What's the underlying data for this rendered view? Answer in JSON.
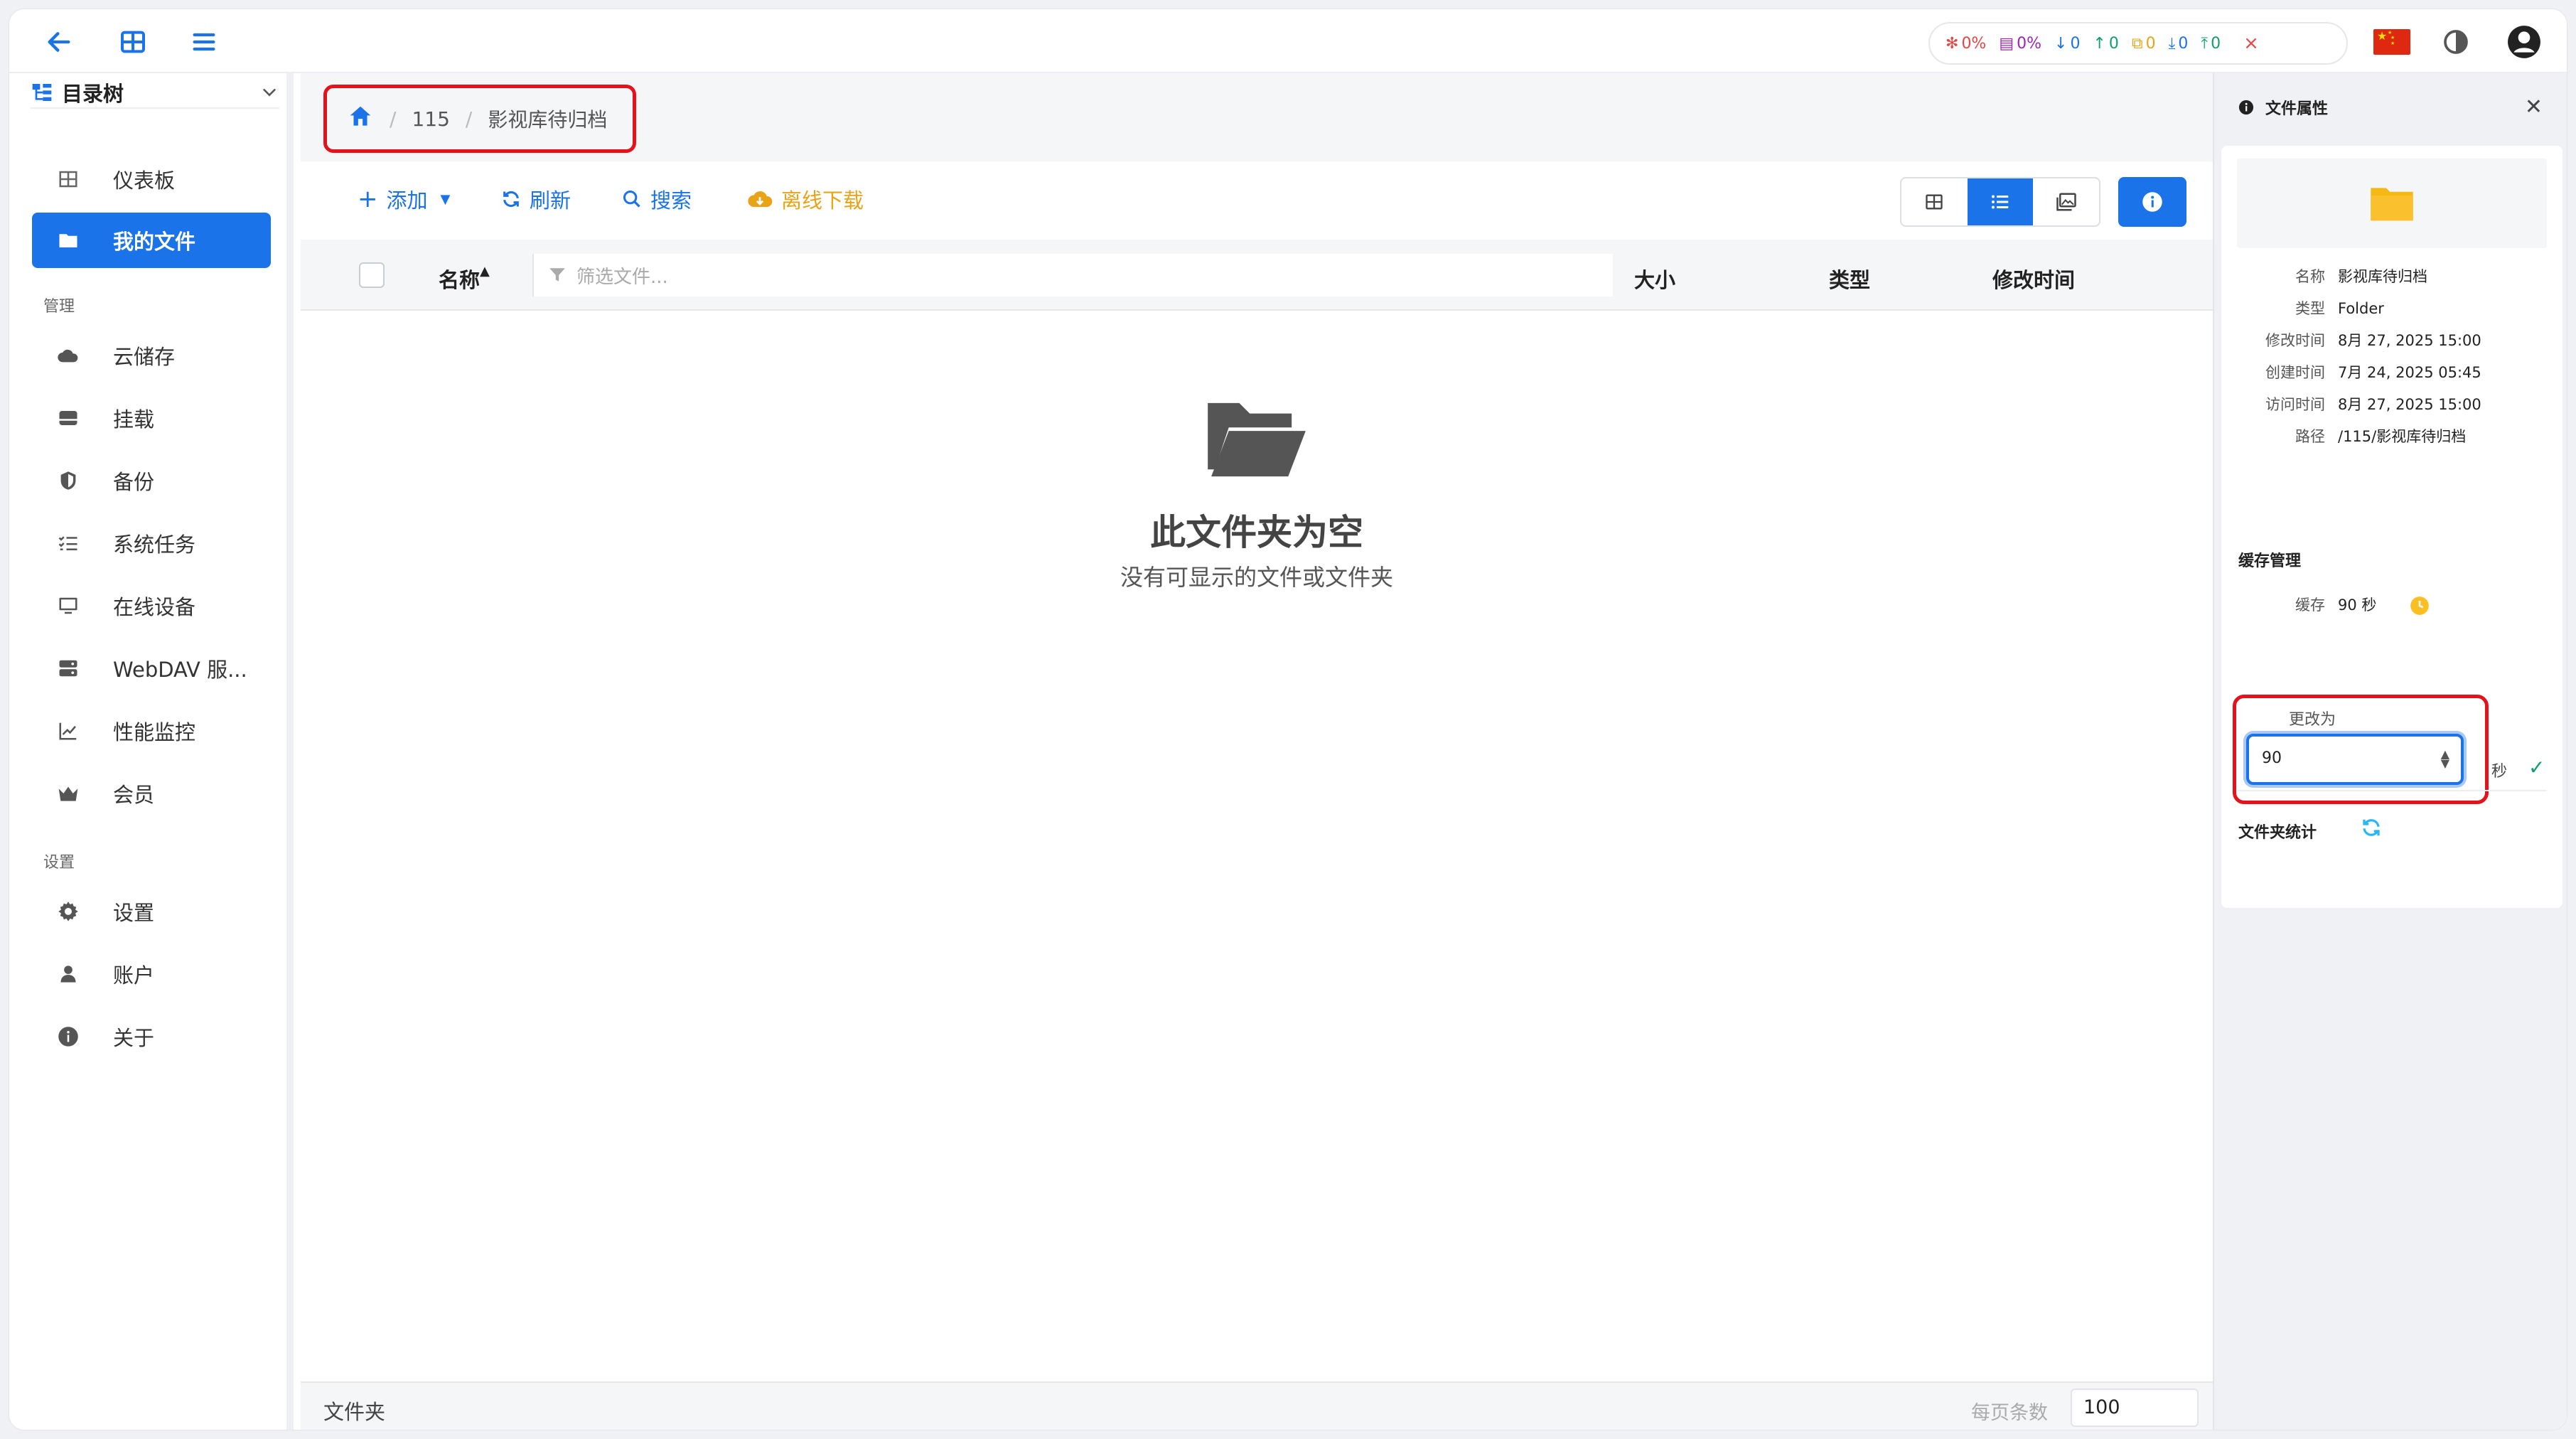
{
  "topbar": {
    "status": [
      {
        "icon": "cpu-icon",
        "value": "0%",
        "color": "#e84545"
      },
      {
        "icon": "memory-icon",
        "value": "0%",
        "color": "#9c27b0"
      },
      {
        "icon": "arrow-down-icon",
        "value": "0",
        "color": "#1a73e8"
      },
      {
        "icon": "arrow-up-icon",
        "value": "0",
        "color": "#0e9f6e"
      },
      {
        "icon": "copy-icon",
        "value": "0",
        "color": "#e8a317"
      },
      {
        "icon": "download-icon",
        "value": "0",
        "color": "#1a73e8"
      },
      {
        "icon": "upload-icon",
        "value": "0",
        "color": "#0e9f6e"
      }
    ]
  },
  "sidebar": {
    "tree_label": "目录树",
    "items": [
      {
        "label": "仪表板",
        "icon": "dashboard-icon"
      },
      {
        "label": "我的文件",
        "icon": "folder-icon",
        "active": true
      }
    ],
    "section_manage": "管理",
    "manage_items": [
      {
        "label": "云储存",
        "icon": "cloud-icon"
      },
      {
        "label": "挂载",
        "icon": "drive-icon"
      },
      {
        "label": "备份",
        "icon": "shield-icon"
      },
      {
        "label": "系统任务",
        "icon": "tasks-icon"
      },
      {
        "label": "在线设备",
        "icon": "monitor-icon"
      },
      {
        "label": "WebDAV 服...",
        "icon": "server-icon"
      },
      {
        "label": "性能监控",
        "icon": "chart-icon"
      },
      {
        "label": "会员",
        "icon": "crown-icon"
      }
    ],
    "section_settings": "设置",
    "settings_items": [
      {
        "label": "设置",
        "icon": "gear-icon"
      },
      {
        "label": "账户",
        "icon": "user-icon"
      },
      {
        "label": "关于",
        "icon": "info-icon"
      }
    ]
  },
  "breadcrumb": {
    "parts": [
      "115",
      "影视库待归档"
    ]
  },
  "toolbar": {
    "add": "添加",
    "refresh": "刷新",
    "search": "搜索",
    "offline": "离线下载"
  },
  "table": {
    "col_name": "名称",
    "filter_placeholder": "筛选文件...",
    "col_size": "大小",
    "col_type": "类型",
    "col_modified": "修改时间"
  },
  "empty": {
    "title": "此文件夹为空",
    "subtitle": "没有可显示的文件或文件夹"
  },
  "footer": {
    "label": "文件夹",
    "per_page_label": "每页条数",
    "per_page_value": "100"
  },
  "panel": {
    "title": "文件属性",
    "props": [
      {
        "k": "名称",
        "v": "影视库待归档"
      },
      {
        "k": "类型",
        "v": "Folder"
      },
      {
        "k": "修改时间",
        "v": "8月 27, 2025 15:00"
      },
      {
        "k": "创建时间",
        "v": "7月 24, 2025 05:45"
      },
      {
        "k": "访问时间",
        "v": "8月 27, 2025 15:00"
      },
      {
        "k": "路径",
        "v": "/115/影视库待归档"
      }
    ],
    "cache_section": "缓存管理",
    "cache_label": "缓存",
    "cache_value": "90 秒",
    "change_label": "更改为",
    "change_value": "90",
    "unit": "秒",
    "folder_stats": "文件夹统计"
  }
}
